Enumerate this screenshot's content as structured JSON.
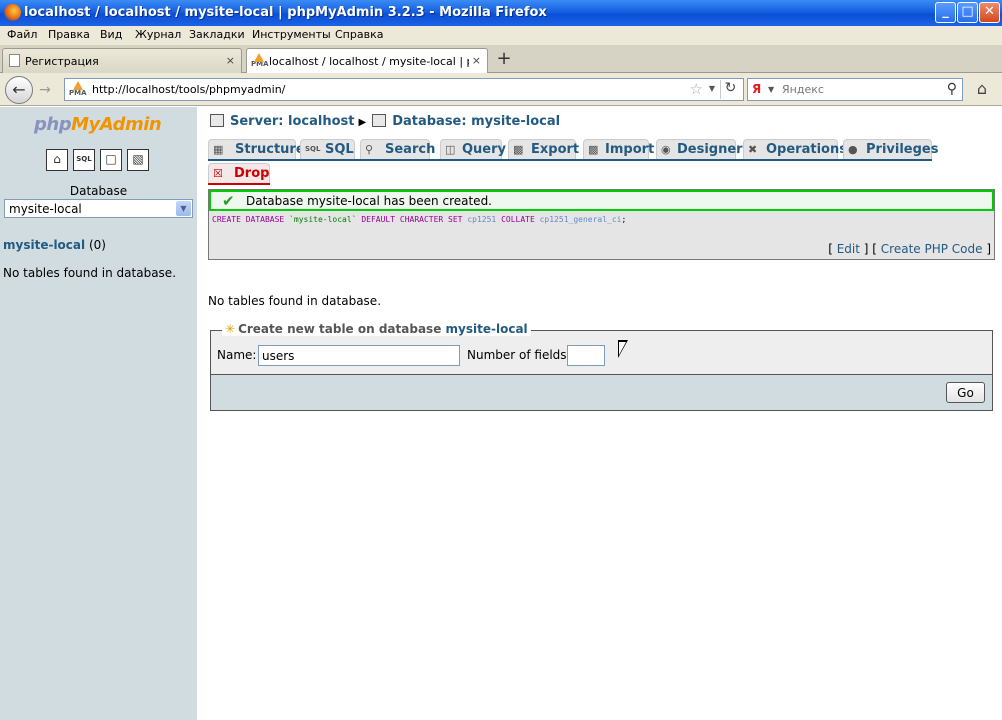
{
  "window": {
    "title": "localhost / localhost / mysite-local | phpMyAdmin 3.2.3 - Mozilla Firefox",
    "minimize": "_",
    "maximize": "□",
    "close": "✕"
  },
  "menu": [
    "Файл",
    "Правка",
    "Вид",
    "Журнал",
    "Закладки",
    "Инструменты",
    "Справка"
  ],
  "browser_tabs": [
    {
      "label": "Регистрация",
      "close": "×",
      "active": false
    },
    {
      "label": "localhost / localhost / mysite-local | phpM...",
      "close": "×",
      "active": true
    }
  ],
  "new_tab": "+",
  "nav": {
    "url": "http://localhost/tools/phpmyadmin/",
    "search_placeholder": "Яндекс",
    "search_engine": "Я"
  },
  "sidebar": {
    "logo_php": "php",
    "logo_myadmin": "MyAdmin",
    "icons": [
      "home-icon",
      "sql-icon",
      "query-window-icon",
      "docs-icon"
    ],
    "database_label": "Database",
    "selected_db": "mysite-local",
    "db_link": "mysite-local",
    "db_count": "(0)",
    "empty_text": "No tables found in database."
  },
  "breadcrumb": {
    "server": "Server: localhost",
    "database": "Database: mysite-local"
  },
  "tabs": [
    {
      "label": "Structure",
      "icon": "structure-icon"
    },
    {
      "label": "SQL",
      "icon": "sql-icon"
    },
    {
      "label": "Search",
      "icon": "search-icon"
    },
    {
      "label": "Query",
      "icon": "query-icon"
    },
    {
      "label": "Export",
      "icon": "export-icon"
    },
    {
      "label": "Import",
      "icon": "import-icon"
    },
    {
      "label": "Designer",
      "icon": "designer-icon"
    },
    {
      "label": "Operations",
      "icon": "operations-icon"
    },
    {
      "label": "Privileges",
      "icon": "privileges-icon"
    },
    {
      "label": "Drop",
      "icon": "drop-icon"
    }
  ],
  "result": {
    "message": "Database mysite-local has been created.",
    "sql": {
      "kw1": "CREATE DATABASE",
      "name": "`mysite-local`",
      "kw2": "DEFAULT CHARACTER SET",
      "charset": "cp1251",
      "kw3": "COLLATE",
      "collation": "cp1251_general_ci",
      "end": ";"
    },
    "edit": "Edit",
    "create_php": "Create PHP Code"
  },
  "main": {
    "empty_text": "No tables found in database."
  },
  "create_table": {
    "legend": "Create new table on database",
    "legend_db": "mysite-local",
    "name_label": "Name:",
    "name_value": "users",
    "fields_label": "Number of fields:",
    "fields_value": "",
    "go": "Go"
  },
  "colors": {
    "link": "#235a81",
    "success_border": "#00cc00",
    "drop": "#cc0000",
    "sidebar_bg": "#d0dce0"
  }
}
